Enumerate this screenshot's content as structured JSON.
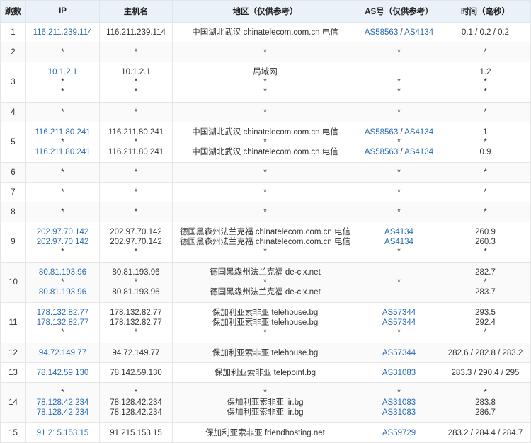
{
  "headers": {
    "hop": "跳数",
    "ip": "IP",
    "host": "主机名",
    "geo": "地区（仅供参考）",
    "as": "AS号（仅供参考）",
    "time": "时间（毫秒）"
  },
  "rows": [
    {
      "hop": "1",
      "ip": [
        "116.211.239.114"
      ],
      "host": [
        "116.211.239.114"
      ],
      "geo": [
        "中国湖北武汉 chinatelecom.com.cn 电信"
      ],
      "as": [
        [
          "AS58563",
          "AS4134"
        ]
      ],
      "time": [
        "0.1 / 0.2 / 0.2"
      ]
    },
    {
      "hop": "2",
      "ip": [
        "*"
      ],
      "host": [
        "*"
      ],
      "geo": [
        "*"
      ],
      "as": [
        [
          "*"
        ]
      ],
      "time": [
        "*"
      ]
    },
    {
      "hop": "3",
      "ip": [
        "10.1.2.1",
        "*",
        "*"
      ],
      "host": [
        "10.1.2.1",
        "*",
        "*"
      ],
      "geo": [
        "局域网",
        "*",
        "*"
      ],
      "as": [
        [
          ""
        ],
        [
          "*"
        ],
        [
          "*"
        ]
      ],
      "time": [
        "1.2",
        "*",
        "*"
      ]
    },
    {
      "hop": "4",
      "ip": [
        "*"
      ],
      "host": [
        "*"
      ],
      "geo": [
        "*"
      ],
      "as": [
        [
          "*"
        ]
      ],
      "time": [
        "*"
      ]
    },
    {
      "hop": "5",
      "ip": [
        "116.211.80.241",
        "*",
        "116.211.80.241"
      ],
      "host": [
        "116.211.80.241",
        "*",
        "116.211.80.241"
      ],
      "geo": [
        "中国湖北武汉 chinatelecom.com.cn 电信",
        "*",
        "中国湖北武汉 chinatelecom.com.cn 电信"
      ],
      "as": [
        [
          "AS58563",
          "AS4134"
        ],
        [
          "*"
        ],
        [
          "AS58563",
          "AS4134"
        ]
      ],
      "time": [
        "1",
        "*",
        "0.9"
      ]
    },
    {
      "hop": "6",
      "ip": [
        "*"
      ],
      "host": [
        "*"
      ],
      "geo": [
        "*"
      ],
      "as": [
        [
          "*"
        ]
      ],
      "time": [
        "*"
      ]
    },
    {
      "hop": "7",
      "ip": [
        "*"
      ],
      "host": [
        "*"
      ],
      "geo": [
        "*"
      ],
      "as": [
        [
          "*"
        ]
      ],
      "time": [
        "*"
      ]
    },
    {
      "hop": "8",
      "ip": [
        "*"
      ],
      "host": [
        "*"
      ],
      "geo": [
        "*"
      ],
      "as": [
        [
          "*"
        ]
      ],
      "time": [
        "*"
      ]
    },
    {
      "hop": "9",
      "ip": [
        "202.97.70.142",
        "202.97.70.142",
        "*"
      ],
      "host": [
        "202.97.70.142",
        "202.97.70.142",
        "*"
      ],
      "geo": [
        "德国黑森州法兰克福 chinatelecom.com.cn 电信",
        "德国黑森州法兰克福 chinatelecom.com.cn 电信",
        "*"
      ],
      "as": [
        [
          "AS4134"
        ],
        [
          "AS4134"
        ],
        [
          "*"
        ]
      ],
      "time": [
        "260.9",
        "260.3",
        "*"
      ]
    },
    {
      "hop": "10",
      "ip": [
        "80.81.193.96",
        "*",
        "80.81.193.96"
      ],
      "host": [
        "80.81.193.96",
        "*",
        "80.81.193.96"
      ],
      "geo": [
        "德国黑森州法兰克福 de-cix.net",
        "*",
        "德国黑森州法兰克福 de-cix.net"
      ],
      "as": [
        [
          ""
        ],
        [
          "*"
        ],
        [
          ""
        ]
      ],
      "time": [
        "282.7",
        "*",
        "283.7"
      ]
    },
    {
      "hop": "11",
      "ip": [
        "178.132.82.77",
        "178.132.82.77",
        "*"
      ],
      "host": [
        "178.132.82.77",
        "178.132.82.77",
        "*"
      ],
      "geo": [
        "保加利亚索非亚 telehouse.bg",
        "保加利亚索非亚 telehouse.bg",
        "*"
      ],
      "as": [
        [
          "AS57344"
        ],
        [
          "AS57344"
        ],
        [
          "*"
        ]
      ],
      "time": [
        "293.5",
        "292.4",
        "*"
      ]
    },
    {
      "hop": "12",
      "ip": [
        "94.72.149.77"
      ],
      "host": [
        "94.72.149.77"
      ],
      "geo": [
        "保加利亚索非亚 telehouse.bg"
      ],
      "as": [
        [
          "AS57344"
        ]
      ],
      "time": [
        "282.6 / 282.8 / 283.2"
      ]
    },
    {
      "hop": "13",
      "ip": [
        "78.142.59.130"
      ],
      "host": [
        "78.142.59.130"
      ],
      "geo": [
        "保加利亚索非亚 telepoint.bg"
      ],
      "as": [
        [
          "AS31083"
        ]
      ],
      "time": [
        "283.3 / 290.4 / 295"
      ]
    },
    {
      "hop": "14",
      "ip": [
        "*",
        "78.128.42.234",
        "78.128.42.234"
      ],
      "host": [
        "*",
        "78.128.42.234",
        "78.128.42.234"
      ],
      "geo": [
        "*",
        "保加利亚索非亚 lir.bg",
        "保加利亚索非亚 lir.bg"
      ],
      "as": [
        [
          "*"
        ],
        [
          "AS31083"
        ],
        [
          "AS31083"
        ]
      ],
      "time": [
        "*",
        "283.8",
        "286.7"
      ]
    },
    {
      "hop": "15",
      "ip": [
        "91.215.153.15"
      ],
      "host": [
        "91.215.153.15"
      ],
      "geo": [
        "保加利亚索非亚 friendhosting.net"
      ],
      "as": [
        [
          "AS59729"
        ]
      ],
      "time": [
        "283.2 / 284.4 / 284.7"
      ]
    }
  ]
}
